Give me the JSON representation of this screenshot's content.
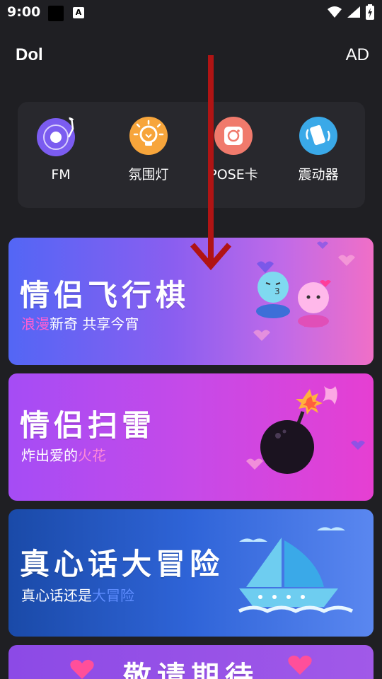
{
  "status_bar": {
    "time": "9:00",
    "notification_letter": "A"
  },
  "header": {
    "title": "Dol",
    "ad_label": "AD"
  },
  "tools": [
    {
      "label": "FM",
      "icon": "radio-icon"
    },
    {
      "label": "氛围灯",
      "icon": "lightbulb-icon"
    },
    {
      "label": "POSE卡",
      "icon": "camera-icon"
    },
    {
      "label": "震动器",
      "icon": "phone-vibrate-icon"
    }
  ],
  "banners": [
    {
      "title": "情侣飞行棋",
      "subtitle_highlight": "浪漫",
      "subtitle_rest": "新奇 共享今宵"
    },
    {
      "title": "情侣扫雷",
      "subtitle_plain": "炸出爱的",
      "subtitle_highlight": "火花"
    },
    {
      "title": "真心话大冒险",
      "subtitle_hl1": "真心话",
      "subtitle_mid": "还是",
      "subtitle_hl2": "大冒险"
    },
    {
      "title": "敬请期待"
    }
  ],
  "colors": {
    "background": "#1f1f23",
    "panel": "#28282d",
    "arrow": "#b01414"
  }
}
